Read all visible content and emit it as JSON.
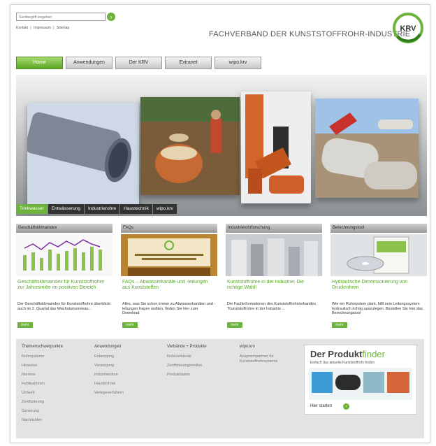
{
  "header": {
    "search_placeholder": "Suchbegriff eingeben",
    "search_go": "›",
    "top_links": [
      "Kontakt",
      "|",
      "Impressum",
      "|",
      "Sitemap"
    ],
    "brand": "FACHVERBAND DER KUNSTSTOFFROHR-INDUSTRIE",
    "logo_text": "KRV"
  },
  "nav": {
    "tabs": [
      {
        "label": "Home",
        "active": true
      },
      {
        "label": "Anwendungen",
        "active": false
      },
      {
        "label": "Der KRV",
        "active": false
      },
      {
        "label": "Extranet",
        "active": false
      },
      {
        "label": "wipo.krv",
        "active": false
      }
    ]
  },
  "hero": {
    "subnav": [
      {
        "label": "Trinkwasser",
        "active": true
      },
      {
        "label": "Entwässerung",
        "active": false
      },
      {
        "label": "Industrierohre",
        "active": false
      },
      {
        "label": "Haustechnik",
        "active": false
      },
      {
        "label": "wipo.krv",
        "active": false
      }
    ]
  },
  "boxes": [
    {
      "header": "Geschäftsklimaindex",
      "title": "Geschäftsklimaindex für Kunststoffrohre zur Jahresmitte im positiven Bereich",
      "text": "Der Geschäftsklimaindex für Kunststoffrohre überblickt auch im 2. Quartal das Wachstumsniveau...",
      "more": "mehr"
    },
    {
      "header": "FAQs",
      "title": "FAQs – Abwasserkanäle und -leitungen aus Kunststoffen",
      "text": "Alles, was Sie schon immer zu Abwasserkanälen und -leitungen fragen wollten, finden Sie hier zum Download",
      "more": "mehr"
    },
    {
      "header": "Industrierohrforschung",
      "title": "Kunststoffrohre in der Industrie: Die richtige Wahl!",
      "text": "Die Fachinformationen des Kunststoffrohrverbandes \"Kunststoffrohre in der Industrie ...",
      "more": "mehr"
    },
    {
      "header": "Berechnungstool",
      "title": "Hydraulische Dimensionierung von Druckrohren",
      "text": "Wie ein Rohrsystem plant, hilft sein Leitungssystem hydraulisch richtig auszulegen. Bestellen Sie hier das Berechnungstool",
      "more": "mehr"
    }
  ],
  "footer": {
    "columns": [
      {
        "header": "Themenschwerpunkte",
        "items": [
          "Rohrsysteme",
          "Hinweise",
          "Normen",
          "Publikationen",
          "Umwelt",
          "Zertifizierung",
          "Sanierung",
          "Nachrichten"
        ]
      },
      {
        "header": "Anwendungen",
        "items": [
          "Entsorgung",
          "Versorgung",
          "Industrierohre",
          "Haustechnik",
          "Verlegeverfahren"
        ]
      },
      {
        "header": "Verbände + Produkte",
        "items": [
          "Rohrverbände",
          "Zertifizierungsstellen",
          "Produktdaten"
        ]
      },
      {
        "header": "wipo.krv",
        "items": [
          "Ansprechpartner für Kunststoffrohrsysteme"
        ]
      }
    ],
    "finder": {
      "title_prefix": "Der Produkt",
      "title_suffix": "finder",
      "subtitle": "Einfach das aktuelle Kunststoffrohr finden",
      "cta": "Hier starten",
      "cta_icon": "›"
    }
  }
}
